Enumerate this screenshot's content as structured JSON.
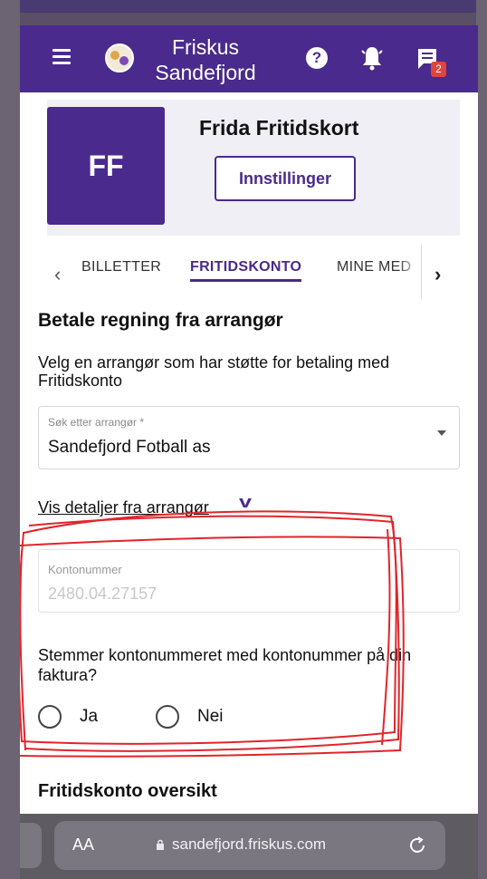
{
  "appbar": {
    "title_line1": "Friskus",
    "title_line2": "Sandefjord",
    "help_glyph": "?",
    "notification_badge": "2",
    "icons": [
      "menu-icon",
      "logo-icon",
      "help-icon",
      "bell-icon",
      "chat-icon"
    ]
  },
  "profile": {
    "initials": "FF",
    "name": "Frida Fritidskort",
    "settings_label": "Innstillinger"
  },
  "tabs": {
    "items": [
      "BILLETTER",
      "FRITIDSKONTO",
      "MINE MED"
    ],
    "active": "FRITIDSKONTO"
  },
  "main": {
    "section_title": "Betale regning fra arrangør",
    "description": "Velg en arrangør som har støtte for betaling med Fritidskonto",
    "search_label": "Søk etter arrangør *",
    "search_value": "Sandefjord Fotball as",
    "details_link": "Vis detaljer fra arrangør",
    "account_label": "Kontonummer",
    "account_value": "2480.04.27157",
    "question": "Stemmer kontonummeret med kontonummer på din faktura?",
    "option_yes": "Ja",
    "option_no": "Nei",
    "overview_title": "Fritidskonto oversikt"
  },
  "browser": {
    "text_size_label": "AA",
    "url": "sandefjord.friskus.com"
  },
  "colors": {
    "brand": "#4a2a8c",
    "annotation": "#e0252b"
  }
}
